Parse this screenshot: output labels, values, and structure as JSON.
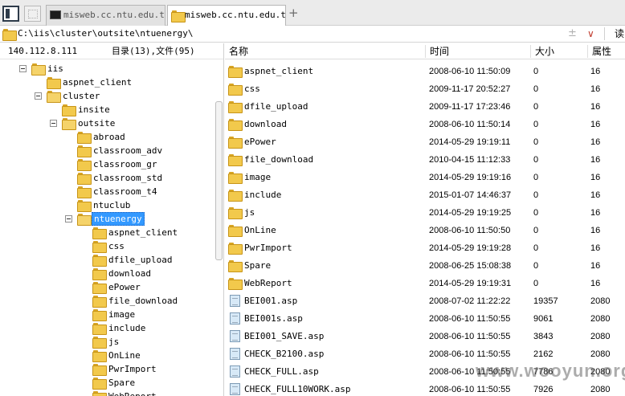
{
  "tabs": [
    {
      "label": "misweb.cc.ntu.edu.tw",
      "icon": "terminal-icon",
      "active": false
    },
    {
      "label": "misweb.cc.ntu.edu.tw",
      "icon": "folder-icon",
      "active": true
    }
  ],
  "new_tab_label": "+",
  "address": {
    "path": "C:\\iis\\cluster\\outsite\\ntuenergy\\",
    "separator": "±",
    "dropdown": "∨",
    "read_button": "读"
  },
  "tree": {
    "ip": "140.112.8.111",
    "count": "目录(13),文件(95)",
    "items": [
      {
        "label": "iis",
        "depth": 0,
        "expanded": true
      },
      {
        "label": "aspnet_client",
        "depth": 1,
        "expanded": false
      },
      {
        "label": "cluster",
        "depth": 1,
        "expanded": true
      },
      {
        "label": "insite",
        "depth": 2,
        "expanded": false
      },
      {
        "label": "outsite",
        "depth": 2,
        "expanded": true
      },
      {
        "label": "abroad",
        "depth": 3,
        "expanded": false
      },
      {
        "label": "classroom_adv",
        "depth": 3,
        "expanded": false
      },
      {
        "label": "classroom_gr",
        "depth": 3,
        "expanded": false
      },
      {
        "label": "classroom_std",
        "depth": 3,
        "expanded": false
      },
      {
        "label": "classroom_t4",
        "depth": 3,
        "expanded": false
      },
      {
        "label": "ntuclub",
        "depth": 3,
        "expanded": false
      },
      {
        "label": "ntuenergy",
        "depth": 3,
        "expanded": true,
        "selected": true
      },
      {
        "label": "aspnet_client",
        "depth": 4,
        "expanded": false
      },
      {
        "label": "css",
        "depth": 4,
        "expanded": false
      },
      {
        "label": "dfile_upload",
        "depth": 4,
        "expanded": false
      },
      {
        "label": "download",
        "depth": 4,
        "expanded": false
      },
      {
        "label": "ePower",
        "depth": 4,
        "expanded": false
      },
      {
        "label": "file_download",
        "depth": 4,
        "expanded": false
      },
      {
        "label": "image",
        "depth": 4,
        "expanded": false
      },
      {
        "label": "include",
        "depth": 4,
        "expanded": false
      },
      {
        "label": "js",
        "depth": 4,
        "expanded": false
      },
      {
        "label": "OnLine",
        "depth": 4,
        "expanded": false
      },
      {
        "label": "PwrImport",
        "depth": 4,
        "expanded": false
      },
      {
        "label": "Spare",
        "depth": 4,
        "expanded": false
      },
      {
        "label": "WebReport",
        "depth": 4,
        "expanded": false
      }
    ]
  },
  "list": {
    "columns": {
      "name": "名称",
      "time": "时间",
      "size": "大小",
      "attr": "属性"
    },
    "rows": [
      {
        "name": "aspnet_client",
        "time": "2008-06-10 11:50:09",
        "size": "0",
        "attr": "16",
        "type": "folder"
      },
      {
        "name": "css",
        "time": "2009-11-17 20:52:27",
        "size": "0",
        "attr": "16",
        "type": "folder"
      },
      {
        "name": "dfile_upload",
        "time": "2009-11-17 17:23:46",
        "size": "0",
        "attr": "16",
        "type": "folder"
      },
      {
        "name": "download",
        "time": "2008-06-10 11:50:14",
        "size": "0",
        "attr": "16",
        "type": "folder"
      },
      {
        "name": "ePower",
        "time": "2014-05-29 19:19:11",
        "size": "0",
        "attr": "16",
        "type": "folder"
      },
      {
        "name": "file_download",
        "time": "2010-04-15 11:12:33",
        "size": "0",
        "attr": "16",
        "type": "folder"
      },
      {
        "name": "image",
        "time": "2014-05-29 19:19:16",
        "size": "0",
        "attr": "16",
        "type": "folder"
      },
      {
        "name": "include",
        "time": "2015-01-07 14:46:37",
        "size": "0",
        "attr": "16",
        "type": "folder"
      },
      {
        "name": "js",
        "time": "2014-05-29 19:19:25",
        "size": "0",
        "attr": "16",
        "type": "folder"
      },
      {
        "name": "OnLine",
        "time": "2008-06-10 11:50:50",
        "size": "0",
        "attr": "16",
        "type": "folder"
      },
      {
        "name": "PwrImport",
        "time": "2014-05-29 19:19:28",
        "size": "0",
        "attr": "16",
        "type": "folder"
      },
      {
        "name": "Spare",
        "time": "2008-06-25 15:08:38",
        "size": "0",
        "attr": "16",
        "type": "folder"
      },
      {
        "name": "WebReport",
        "time": "2014-05-29 19:19:31",
        "size": "0",
        "attr": "16",
        "type": "folder"
      },
      {
        "name": "BEI001.asp",
        "time": "2008-07-02 11:22:22",
        "size": "19357",
        "attr": "2080",
        "type": "file"
      },
      {
        "name": "BEI001s.asp",
        "time": "2008-06-10 11:50:55",
        "size": "9061",
        "attr": "2080",
        "type": "file"
      },
      {
        "name": "BEI001_SAVE.asp",
        "time": "2008-06-10 11:50:55",
        "size": "3843",
        "attr": "2080",
        "type": "file"
      },
      {
        "name": "CHECK_B2100.asp",
        "time": "2008-06-10 11:50:55",
        "size": "2162",
        "attr": "2080",
        "type": "file"
      },
      {
        "name": "CHECK_FULL.asp",
        "time": "2008-06-10 11:50:55",
        "size": "7786",
        "attr": "2080",
        "type": "file"
      },
      {
        "name": "CHECK_FULL10WORK.asp",
        "time": "2008-06-10 11:50:55",
        "size": "7926",
        "attr": "2080",
        "type": "file"
      }
    ]
  },
  "watermark": "www.wooyun.org",
  "colors": {
    "selection": "#3399ff",
    "folder": "#f2c94c",
    "chrome": "#ebebeb"
  }
}
